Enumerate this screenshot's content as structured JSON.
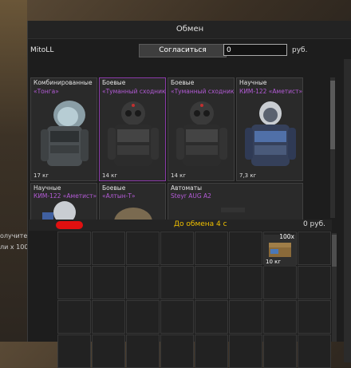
{
  "window": {
    "title": "Обмен"
  },
  "side_panel": {
    "line1": "олучите:",
    "line2": "ли х 100"
  },
  "header": {
    "username": "MitoLL",
    "agree_label": "Согласиться",
    "money_value": "0",
    "currency": "руб."
  },
  "offer": {
    "cards": [
      {
        "category": "Комбинированные",
        "name": "«Тонга»",
        "weight": "17 кг",
        "icon": "combined-suit-icon"
      },
      {
        "category": "Боевые",
        "name": "«Туманный сходник»",
        "weight": "14 кг",
        "icon": "combat-armor-icon"
      },
      {
        "category": "Боевые",
        "name": "«Туманный сходник»",
        "weight": "14 кг",
        "icon": "combat-armor-icon"
      },
      {
        "category": "Научные",
        "name": "КИМ-122 «Аметист»",
        "weight": "7,3 кг",
        "icon": "science-suit-icon"
      }
    ],
    "cards_row2": [
      {
        "category": "Научные",
        "name": "КИМ-122 «Аметист»",
        "icon": "science-suit-icon"
      },
      {
        "category": "Боевые",
        "name": "«Алтын-Т»",
        "icon": "helmet-icon"
      },
      {
        "category": "Автоматы",
        "name": "Steyr AUG A2",
        "icon": "rifle-icon"
      }
    ]
  },
  "status": {
    "countdown": "До обмена 4 с",
    "their_money": "0 руб."
  },
  "inventory": {
    "item": {
      "qty": "100x",
      "weight": "10 кг",
      "icon": "ammo-box-icon"
    }
  },
  "colors": {
    "accent_purple": "#b35bd6",
    "countdown_yellow": "#f0c000",
    "redaction_red": "#e01010"
  }
}
